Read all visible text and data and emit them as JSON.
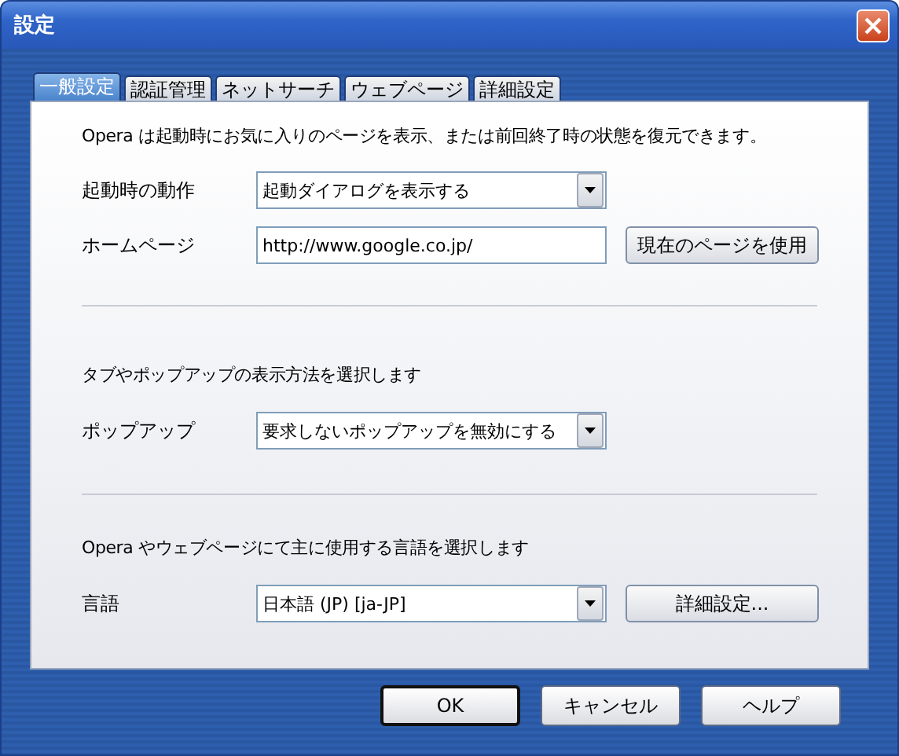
{
  "window": {
    "title": "設定"
  },
  "tabs": [
    {
      "label": "一般設定",
      "selected": true
    },
    {
      "label": "認証管理",
      "selected": false
    },
    {
      "label": "ネットサーチ",
      "selected": false
    },
    {
      "label": "ウェブページ",
      "selected": false
    },
    {
      "label": "詳細設定",
      "selected": false
    }
  ],
  "sections": [
    {
      "description": "Opera は起動時にお気に入りのページを表示、または前回終了時の状態を復元できます。",
      "rows": [
        {
          "kind": "dropdown",
          "label": "起動時の動作",
          "value": "起動ダイアログを表示する"
        },
        {
          "kind": "text",
          "label": "ホームページ",
          "value": "http://www.google.co.jp/",
          "button": "現在のページを使用"
        }
      ]
    },
    {
      "description": "タブやポップアップの表示方法を選択します",
      "rows": [
        {
          "kind": "dropdown",
          "label": "ポップアップ",
          "value": "要求しないポップアップを無効にする"
        }
      ]
    },
    {
      "description": "Opera やウェブページにて主に使用する言語を選択します",
      "rows": [
        {
          "kind": "dropdown",
          "label": "言語",
          "value": "日本語 (JP) [ja-JP]",
          "button": "詳細設定..."
        }
      ]
    }
  ],
  "buttons": [
    {
      "label": "OK",
      "default": true
    },
    {
      "label": "キャンセル",
      "default": false
    },
    {
      "label": "ヘルプ",
      "default": false
    }
  ]
}
